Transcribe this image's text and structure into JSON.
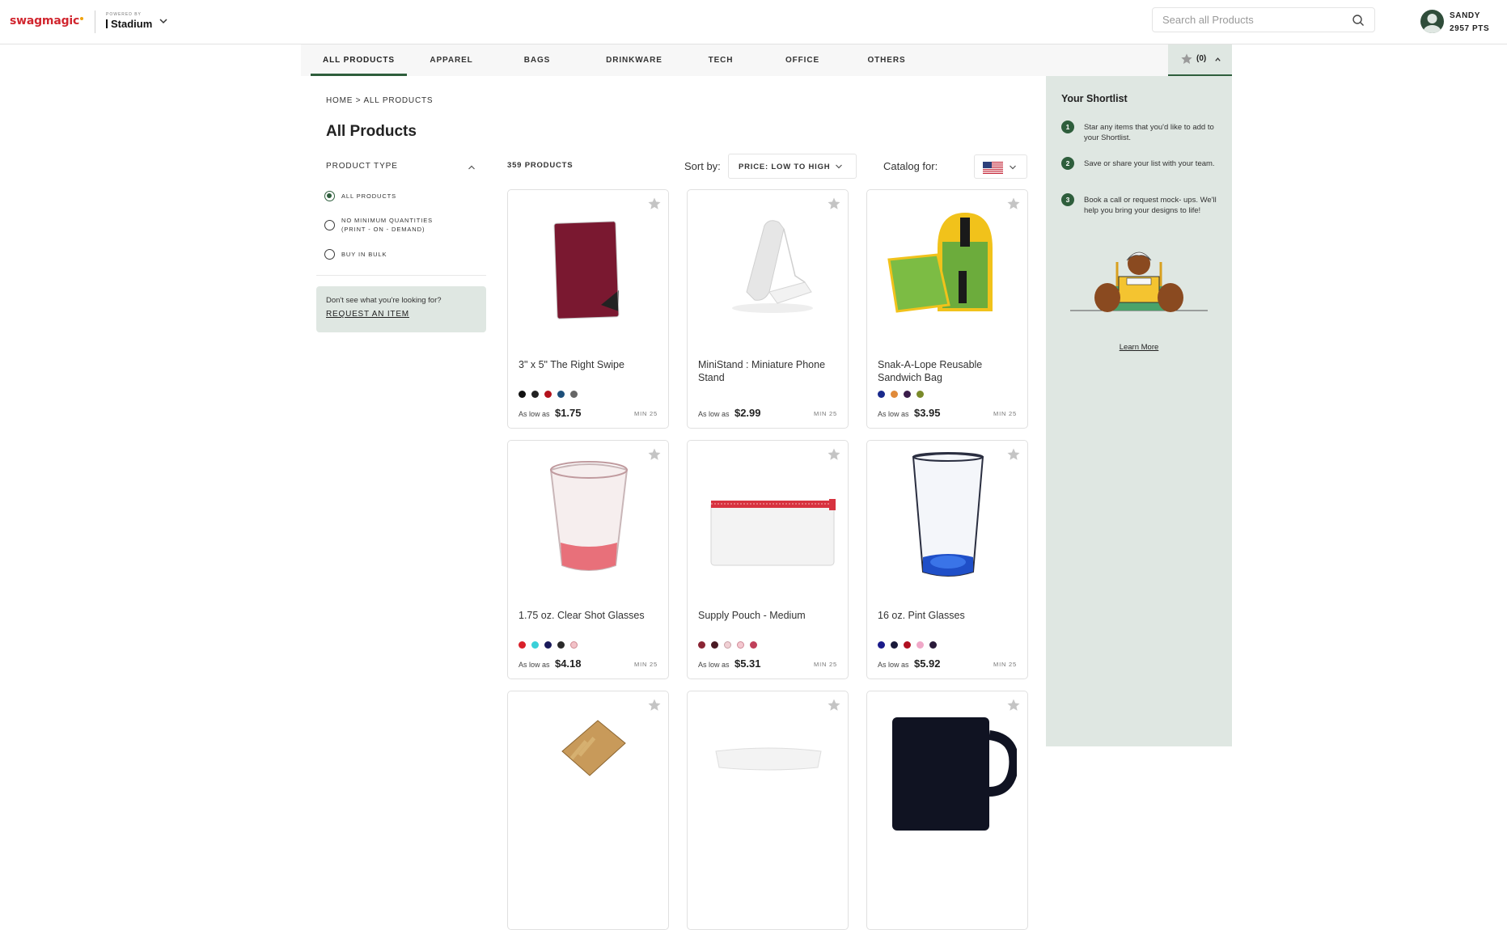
{
  "header": {
    "logo": "swagmagic",
    "powered_by": "POWERED BY",
    "partner": "Stadium",
    "search_placeholder": "Search all Products",
    "user": {
      "name": "SANDY",
      "points": "2957 PTS"
    }
  },
  "nav": {
    "items": [
      {
        "label": "ALL PRODUCTS",
        "active": true
      },
      {
        "label": "APPAREL"
      },
      {
        "label": "BAGS"
      },
      {
        "label": "DRINKWARE"
      },
      {
        "label": "TECH"
      },
      {
        "label": "OFFICE"
      },
      {
        "label": "OTHERS"
      }
    ],
    "shortlist_count": "(0)"
  },
  "breadcrumb": "HOME > ALL PRODUCTS",
  "page_title": "All Products",
  "filters": {
    "heading": "PRODUCT TYPE",
    "options": [
      {
        "line1": "ALL PRODUCTS",
        "line2": "",
        "selected": true
      },
      {
        "line1": "NO MINIMUM QUANTITIES",
        "line2": "(PRINT - ON - DEMAND)",
        "selected": false
      },
      {
        "line1": "BUY IN BULK",
        "line2": "",
        "selected": false
      }
    ],
    "request_text": "Don't see what you're looking for?",
    "request_link": "REQUEST AN ITEM"
  },
  "toolbar": {
    "count": "359 PRODUCTS",
    "sort_label": "Sort by:",
    "sort_value": "PRICE: LOW TO HIGH",
    "catalog_label": "Catalog for:"
  },
  "products": [
    {
      "name": "3\" x 5\" The Right Swipe",
      "price_label": "As low as",
      "price": "$1.75",
      "min": "MIN 25",
      "swatches": [
        "#111111",
        "#222222",
        "#b3121c",
        "#1d4f7a",
        "#666666"
      ]
    },
    {
      "name": "MiniStand : Miniature Phone Stand",
      "price_label": "As low as",
      "price": "$2.99",
      "min": "MIN 25",
      "swatches": []
    },
    {
      "name": "Snak-A-Lope Reusable Sandwich Bag",
      "price_label": "As low as",
      "price": "$3.95",
      "min": "MIN 25",
      "swatches": [
        "#1a2a8c",
        "#e08a3a",
        "#3a1c4a",
        "#7a8a2a"
      ]
    },
    {
      "name": "1.75 oz. Clear Shot Glasses",
      "price_label": "As low as",
      "price": "$4.18",
      "min": "MIN 25",
      "swatches": [
        "#d9202a",
        "#3ad0d8",
        "#1a1a5a",
        "#2a2a2a",
        "#f2c2c8"
      ]
    },
    {
      "name": "Supply Pouch - Medium",
      "price_label": "As low as",
      "price": "$5.31",
      "min": "MIN 25",
      "swatches": [
        "#8a2434",
        "#4a1a24",
        "#f0d0d4",
        "#f4c8d0",
        "#c0405a"
      ]
    },
    {
      "name": "16 oz. Pint Glasses",
      "price_label": "As low as",
      "price": "$5.92",
      "min": "MIN 25",
      "swatches": [
        "#1a1a8a",
        "#1a1a3a",
        "#b01020",
        "#f0a8c8",
        "#2a1a3a"
      ]
    }
  ],
  "shortlist": {
    "title": "Your Shortlist",
    "steps": [
      {
        "num": "1",
        "text": "Star any items that you'd like to add to your Shortlist."
      },
      {
        "num": "2",
        "text": "Save or share your list with your team."
      },
      {
        "num": "3",
        "text": "Book a call or request mock- ups. We'll help you bring your designs to life!"
      }
    ],
    "learn_more": "Learn More"
  },
  "colors": {
    "brand_red": "#d1262f",
    "accent_green": "#2e5e3c",
    "panel_bg": "#dfe7e2"
  }
}
